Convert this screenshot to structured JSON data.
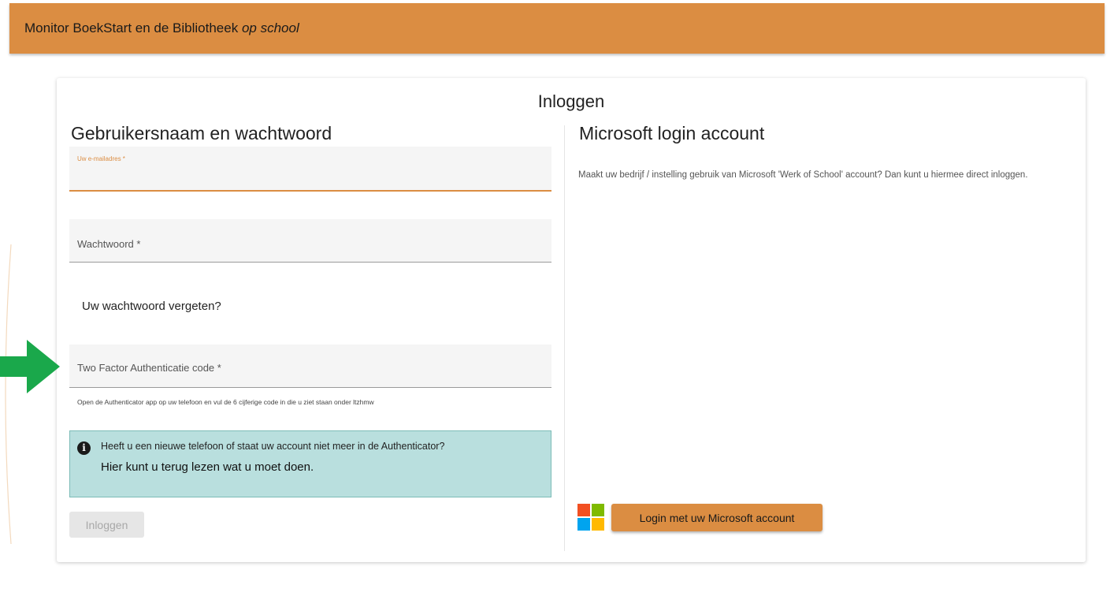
{
  "header": {
    "title_main": "Monitor BoekStart en de Bibliotheek",
    "title_em": "op school"
  },
  "card": {
    "title": "Inloggen"
  },
  "login_form": {
    "section_title": "Gebruikersnaam en wachtwoord",
    "email_label": "Uw e-mailadres *",
    "email_value": "",
    "password_label": "Wachtwoord *",
    "password_value": "",
    "forgot_link": "Uw wachtwoord vergeten?",
    "tfa_label": "Two Factor Authenticatie code *",
    "tfa_value": "",
    "tfa_hint": "Open de Authenticator app op uw telefoon en vul de 6 cijferige code in die u ziet staan onder ltzhmw",
    "info_line": "Heeft u een nieuwe telefoon of staat uw account niet meer in de Authenticator?",
    "info_link": "Hier kunt u terug lezen wat u moet doen.",
    "login_button": "Inloggen"
  },
  "microsoft": {
    "section_title": "Microsoft login account",
    "description": "Maakt uw bedrijf / instelling gebruik van Microsoft 'Werk of School' account? Dan kunt u hiermee direct inloggen.",
    "button_label": "Login met uw Microsoft account",
    "logo_colors": [
      "#f25022",
      "#7fba00",
      "#00a4ef",
      "#ffb900"
    ]
  },
  "colors": {
    "accent": "#db8d42",
    "info_background": "#b9dfde",
    "arrow": "#1aa84b"
  },
  "icons": {
    "info": "info-circle-icon",
    "arrow": "arrow-right-icon",
    "microsoft": "microsoft-logo-icon"
  }
}
